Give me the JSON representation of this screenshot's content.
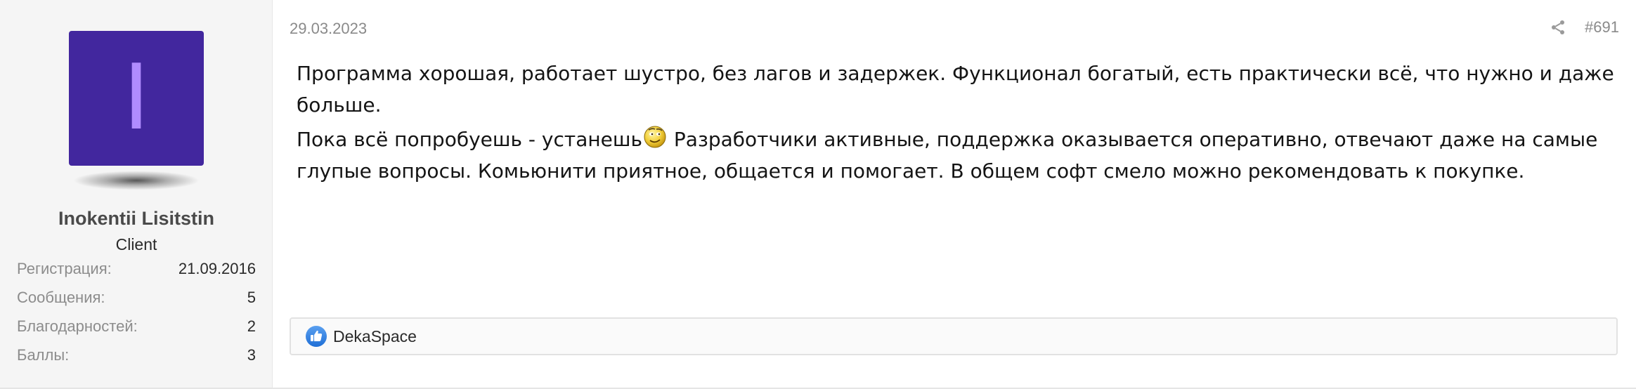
{
  "user": {
    "avatar_letter": "I",
    "avatar_bg": "#42279e",
    "avatar_fg": "#b08cff",
    "name": "Inokentii Lisitstin",
    "title": "Client",
    "stats": [
      {
        "label": "Регистрация:",
        "value": "21.09.2016"
      },
      {
        "label": "Сообщения:",
        "value": "5"
      },
      {
        "label": "Благодарностей:",
        "value": "2"
      },
      {
        "label": "Баллы:",
        "value": "3"
      }
    ]
  },
  "post": {
    "date": "29.03.2023",
    "number": "#691",
    "share_icon": "share-icon",
    "line1": "Программа хорошая, работает шустро, без лагов и задержек. Функционал богатый, есть практически всё, что нужно и даже больше.",
    "line2_before": "Пока всё попробуешь - устанешь",
    "smiley_icon": "thinking-smiley-icon",
    "line2_after": " Разработчики активные, поддержка оказывается оперативно, отвечают даже на самые глупые вопросы. Комьюнити приятное, общается и помогает. В общем софт смело можно рекомендовать к покупке."
  },
  "reactions": {
    "icon": "thumbs-up-icon",
    "users": "DekaSpace"
  }
}
